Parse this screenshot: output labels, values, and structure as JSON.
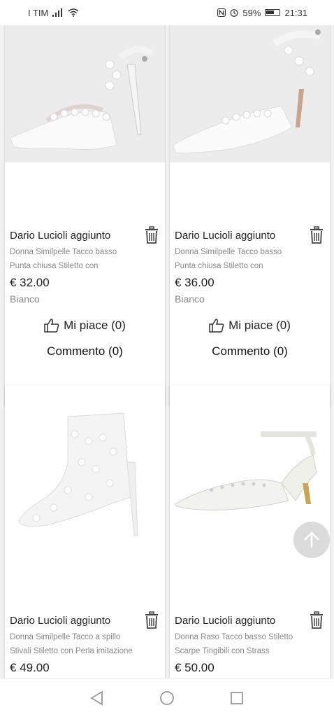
{
  "status_bar": {
    "carrier": "I TIM",
    "battery": "59%",
    "time": "21:31",
    "icons": [
      "signal-icon",
      "wifi-icon",
      "nfc-icon",
      "alarm-icon",
      "battery-icon"
    ]
  },
  "products": [
    {
      "author": "Dario Lucioli aggiunto",
      "desc_line1": "Donna Similpelle Tacco basso",
      "desc_line2": "Punta chiusa Stiletto con",
      "price": "€ 32.00",
      "color": "Bianco",
      "like_label": "Mi piace (0)",
      "comment_label": "Commento (0)"
    },
    {
      "author": "Dario Lucioli aggiunto",
      "desc_line1": "Donna Similpelle Tacco basso",
      "desc_line2": "Punta chiusa Stiletto con",
      "price": "€ 36.00",
      "color": "Bianco",
      "like_label": "Mi piace (0)",
      "comment_label": "Commento (0)"
    },
    {
      "author": "Dario Lucioli aggiunto",
      "desc_line1": "Donna Similpelle Tacco a spillo",
      "desc_line2": "Stivali Stiletto con Perla imitazione",
      "price": "€ 49.00"
    },
    {
      "author": "Dario Lucioli aggiunto",
      "desc_line1": "Donna Raso Tacco basso Stiletto",
      "desc_line2": "Scarpe Tingibili con Strass",
      "price": "€ 50.00"
    }
  ],
  "colors": {
    "text": "#222222",
    "muted": "#888888",
    "card": "#ffffff",
    "background": "#f2f2f2"
  }
}
